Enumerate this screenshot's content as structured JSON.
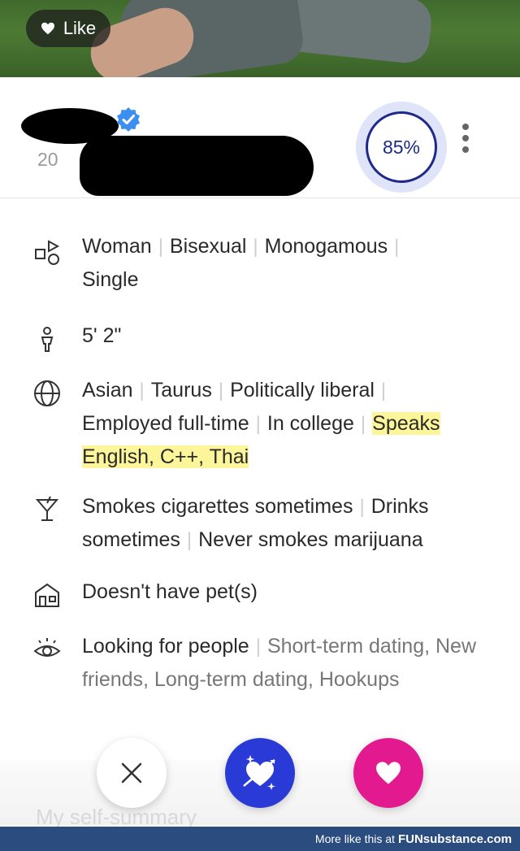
{
  "photo": {
    "like_label": "Like"
  },
  "profile": {
    "age": "20",
    "match_percent": "85%"
  },
  "details": [
    {
      "icon": "gender-shapes-icon",
      "items": [
        "Woman",
        "Bisexual",
        "Monogamous",
        "Single"
      ]
    },
    {
      "icon": "person-height-icon",
      "items": [
        "5' 2\""
      ]
    },
    {
      "icon": "globe-icon",
      "items": [
        "Asian",
        "Taurus",
        "Politically liberal",
        "Employed full-time",
        "In college"
      ],
      "highlight": "Speaks English, C++, Thai"
    },
    {
      "icon": "cocktail-icon",
      "items": [
        "Smokes cigarettes sometimes",
        "Drinks sometimes",
        "Never smokes marijuana"
      ]
    },
    {
      "icon": "house-icon",
      "items": [
        "Doesn't have pet(s)"
      ]
    },
    {
      "icon": "eye-icon",
      "lead": "Looking for people",
      "rest": "Short-term dating, New friends, Long-term dating, Hookups"
    }
  ],
  "bottom": {
    "self_summary_label": "My self-summary"
  },
  "footer": {
    "text": "More like this at",
    "brand": "FUNsubstance.com"
  },
  "colors": {
    "accent": "#1d2a8c",
    "superlike": "#2a3ad6",
    "like": "#e3198f",
    "highlight": "#fdf59a"
  }
}
